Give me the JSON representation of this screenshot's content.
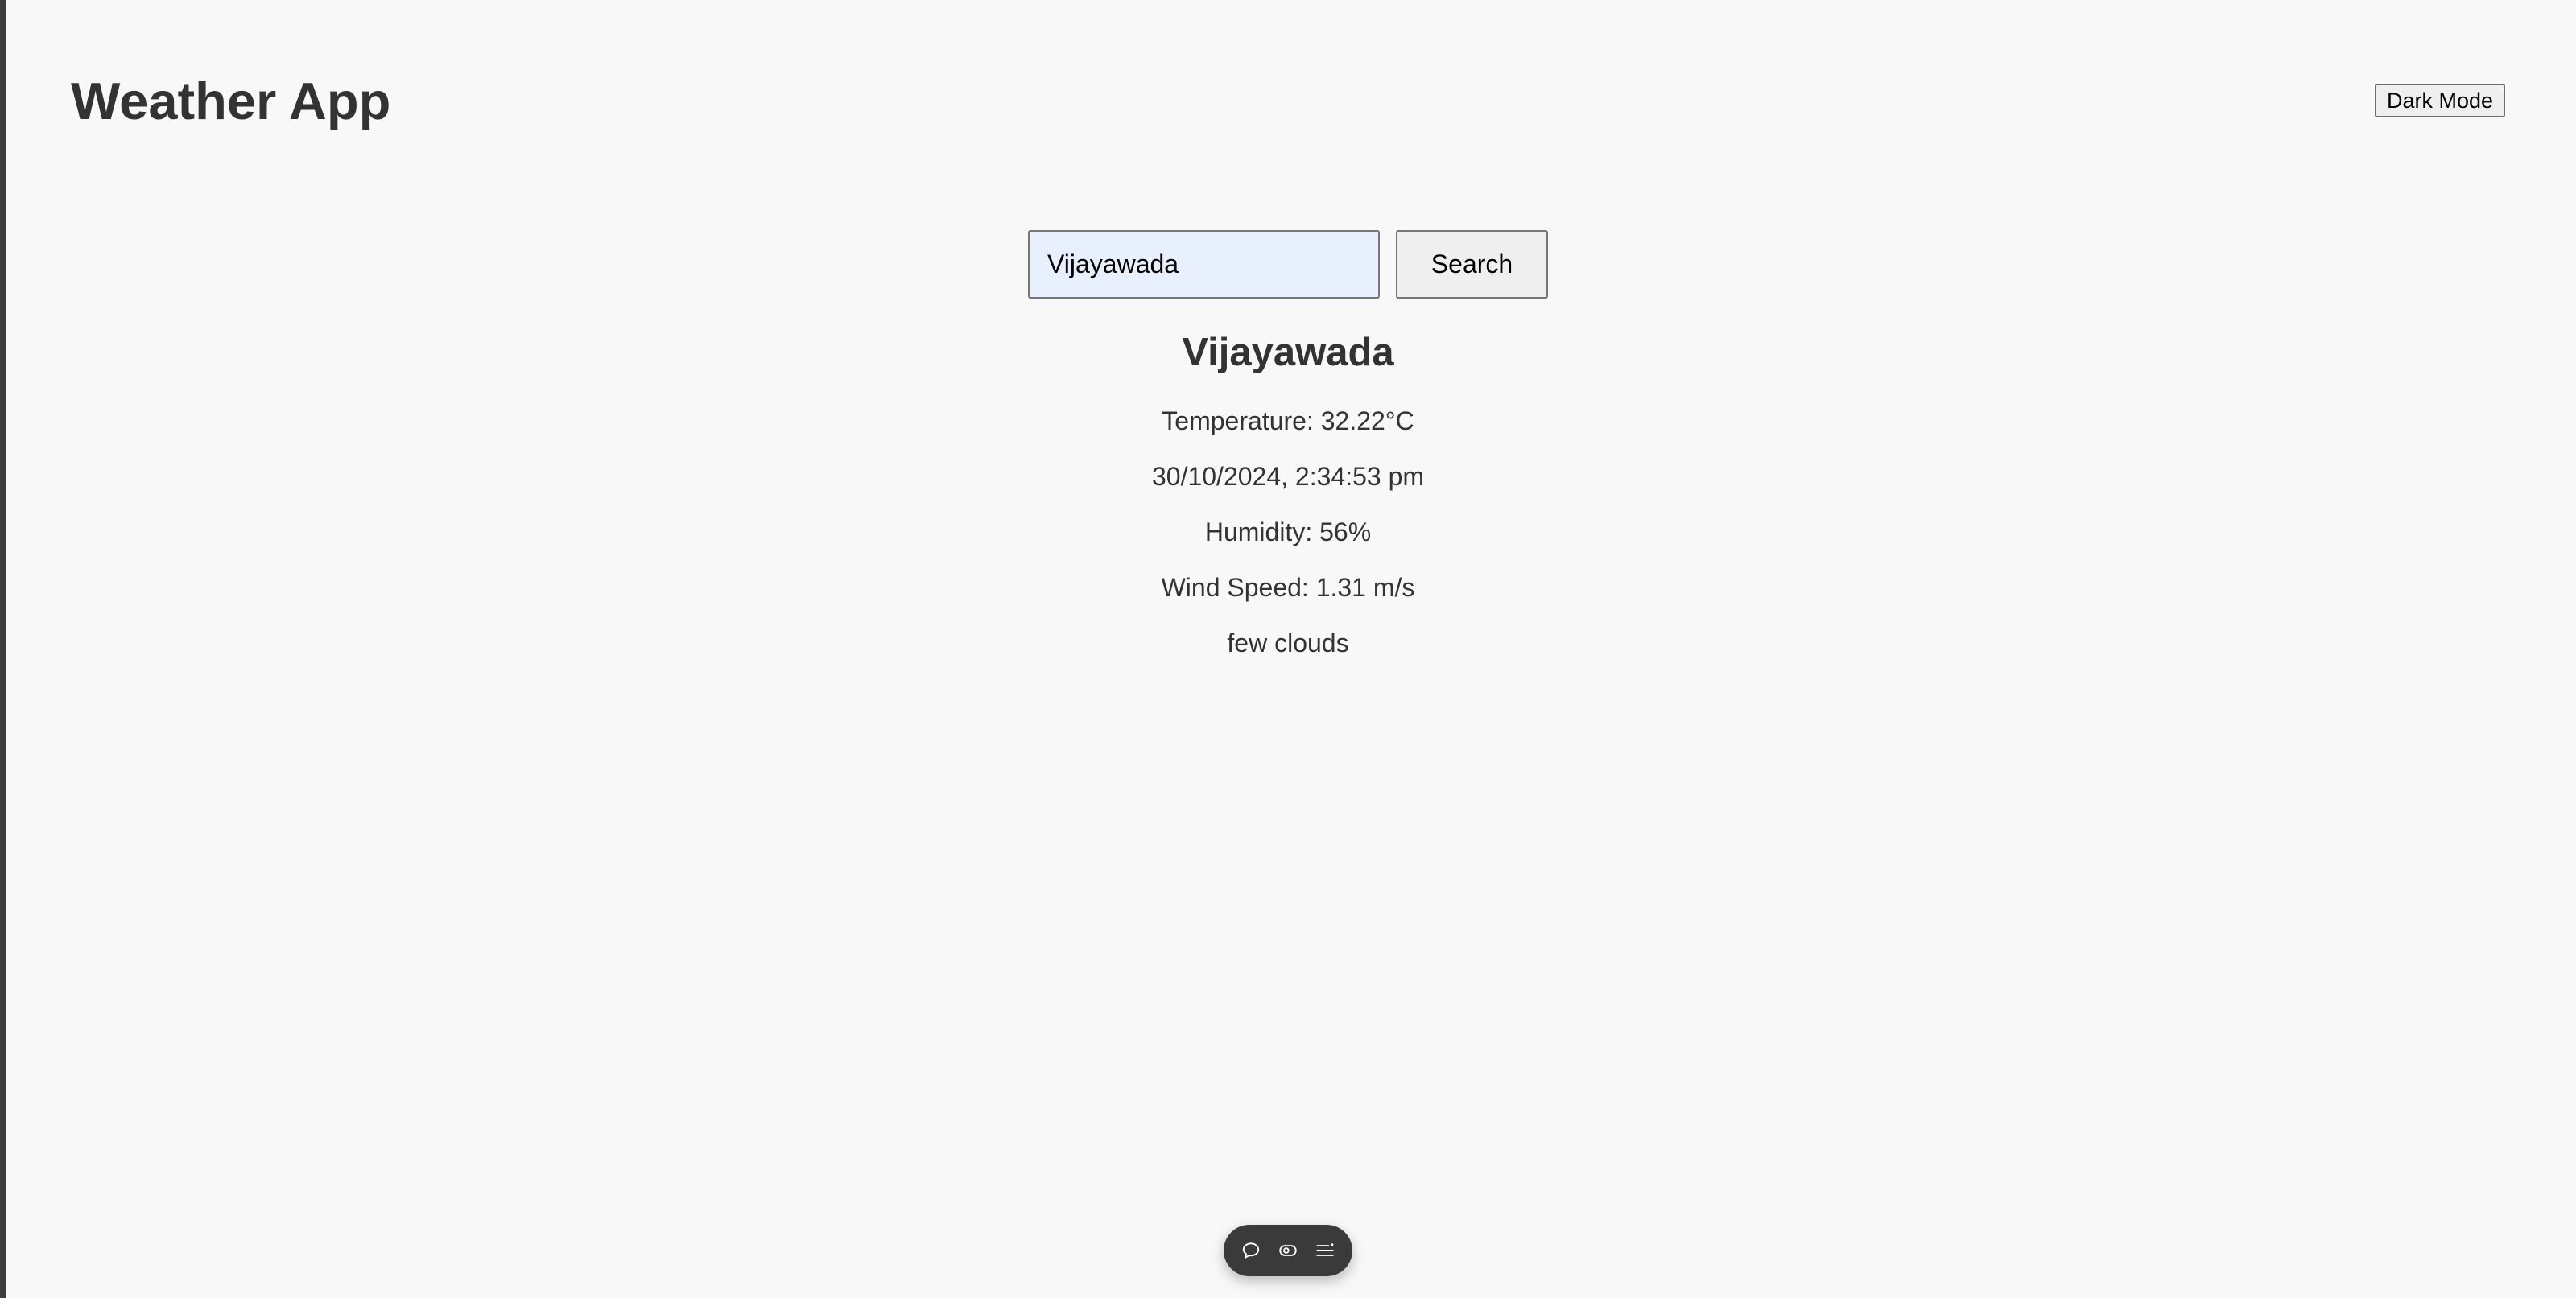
{
  "app": {
    "title": "Weather App",
    "dark_mode_label": "Dark Mode"
  },
  "search": {
    "value": "Vijayawada",
    "button_label": "Search"
  },
  "weather": {
    "city": "Vijayawada",
    "temperature": "Temperature: 32.22°C",
    "datetime": "30/10/2024, 2:34:53 pm",
    "humidity": "Humidity: 56%",
    "wind_speed": "Wind Speed: 1.31 m/s",
    "description": "few clouds"
  },
  "toolbar": {
    "icons": [
      "comment-icon",
      "eye-icon",
      "menu-icon"
    ],
    "icon_color": "#ffffff",
    "background": "#3a3a3a"
  }
}
